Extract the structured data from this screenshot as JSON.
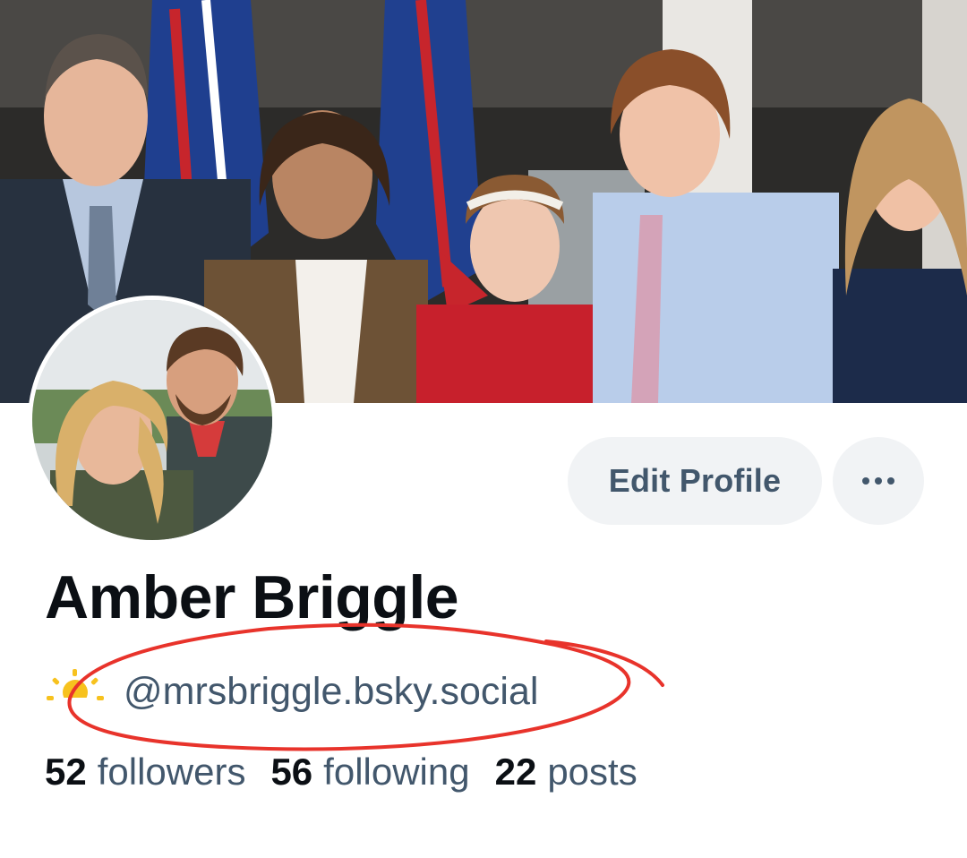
{
  "profile": {
    "display_name": "Amber Briggle",
    "handle": "@mrsbriggle.bsky.social",
    "handle_emoji": "sun-behind-cloud-icon"
  },
  "actions": {
    "edit_label": "Edit Profile",
    "more_icon": "ellipsis-icon"
  },
  "stats": [
    {
      "value": "52",
      "label": "followers"
    },
    {
      "value": "56",
      "label": "following"
    },
    {
      "value": "22",
      "label": "posts"
    }
  ],
  "colors": {
    "primary_text": "#0b0f14",
    "secondary_text": "#42576c",
    "button_bg": "#f1f3f5",
    "annotation": "#e8332b",
    "sun": "#f7c21e"
  }
}
